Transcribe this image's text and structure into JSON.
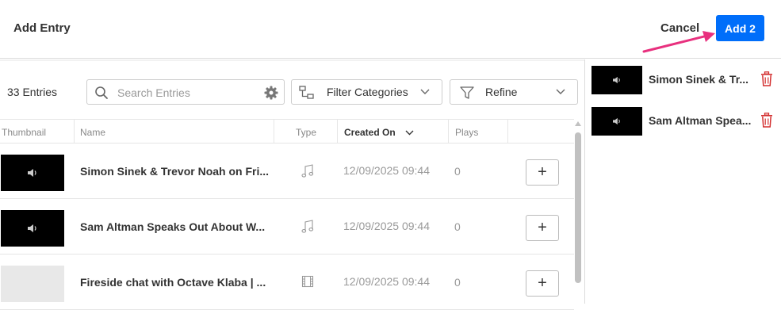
{
  "header": {
    "title": "Add Entry",
    "cancel_label": "Cancel",
    "add_label": "Add 2"
  },
  "toolbar": {
    "count": "33 Entries",
    "search_placeholder": "Search Entries",
    "filter_label": "Filter Categories",
    "refine_label": "Refine"
  },
  "table": {
    "columns": {
      "thumbnail": "Thumbnail",
      "name": "Name",
      "type": "Type",
      "created_on": "Created On",
      "plays": "Plays"
    },
    "rows": [
      {
        "name": "Simon Sinek & Trevor Noah on Fri...",
        "type_icon": "audio-icon",
        "created": "12/09/2025 09:44",
        "plays": "0",
        "thumb": "audio"
      },
      {
        "name": "Sam Altman Speaks Out About W...",
        "type_icon": "audio-icon",
        "created": "12/09/2025 09:44",
        "plays": "0",
        "thumb": "audio"
      },
      {
        "name": "Fireside chat with Octave Klaba | ...",
        "type_icon": "video-icon",
        "created": "12/09/2025 09:44",
        "plays": "0",
        "thumb": "empty"
      }
    ],
    "add_symbol": "+"
  },
  "selected": [
    {
      "name": "Simon Sinek & Tr..."
    },
    {
      "name": "Sam Altman Spea..."
    }
  ],
  "colors": {
    "accent": "#006efa",
    "arrow": "#e8307e",
    "delete": "#d32f2f"
  }
}
